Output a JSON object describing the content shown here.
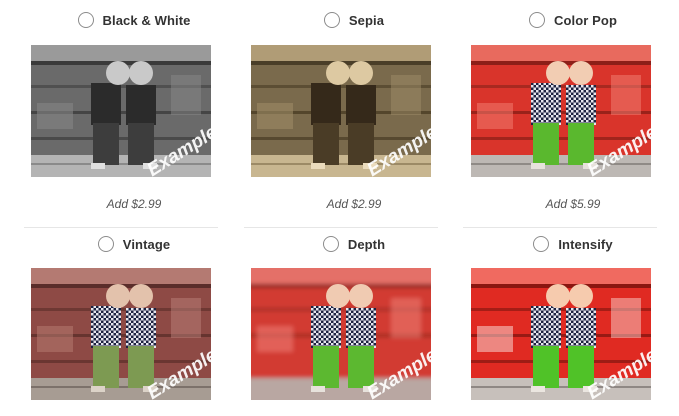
{
  "options": [
    {
      "id": "bw",
      "label": "Black & White",
      "price": "Add $2.99",
      "selected": false
    },
    {
      "id": "sepia",
      "label": "Sepia",
      "price": "Add $2.99",
      "selected": false
    },
    {
      "id": "colorpop",
      "label": "Color Pop",
      "price": "Add $5.99",
      "selected": false
    },
    {
      "id": "vintage",
      "label": "Vintage",
      "selected": false
    },
    {
      "id": "depth",
      "label": "Depth",
      "selected": false
    },
    {
      "id": "intensify",
      "label": "Intensify",
      "selected": false
    }
  ],
  "watermark": "Example"
}
